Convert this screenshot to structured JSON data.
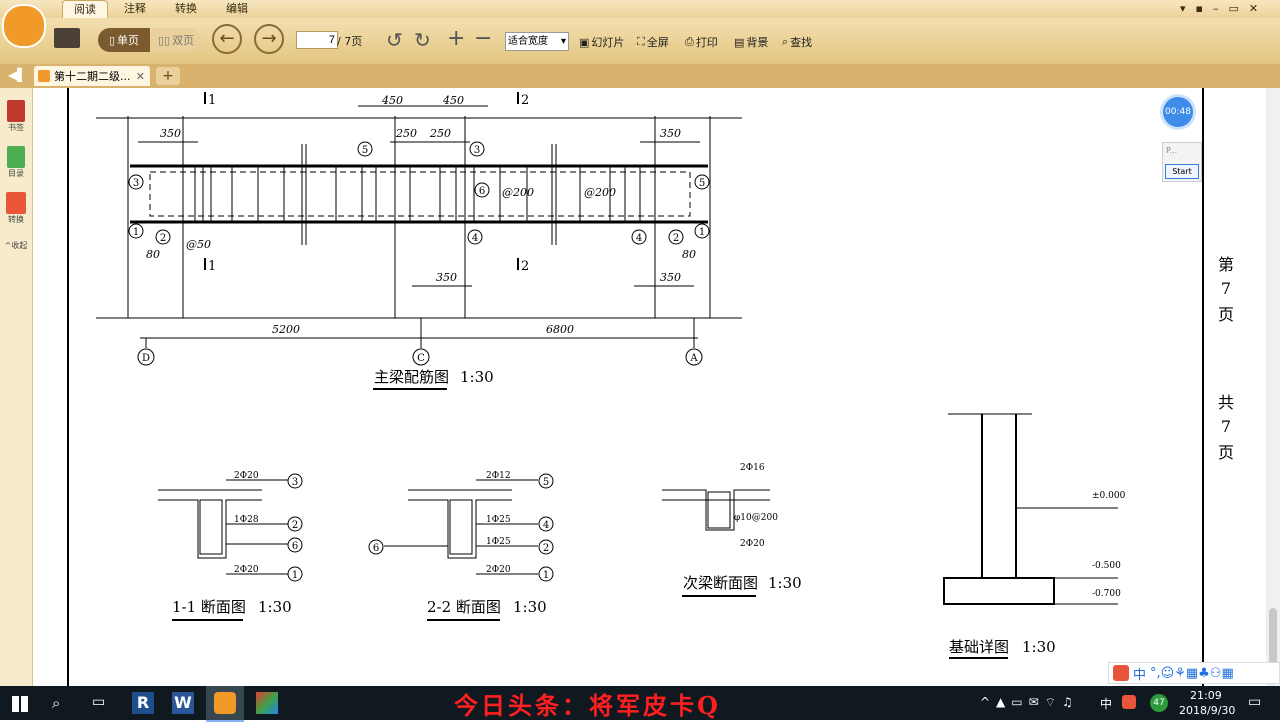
{
  "menu": {
    "tabs": [
      "阅读",
      "注释",
      "转换",
      "编辑"
    ]
  },
  "toolbar": {
    "single_page": "单页",
    "double_page": "双页",
    "page_current": "7",
    "page_total": "/ 7页",
    "zoom_mode": "适合宽度",
    "slideshow": "幻灯片",
    "fullscreen": "全屏",
    "print": "打印",
    "background": "背景",
    "find": "查找"
  },
  "tab": {
    "title": "第十二期二级..."
  },
  "sidebar": {
    "bookmark": "书签",
    "toc": "目录",
    "convert": "转换",
    "collapse": "收起"
  },
  "overlay": {
    "timer": "00:48",
    "widget_text": "P...",
    "start_button": "Start"
  },
  "drawing": {
    "beam_title": "主梁配筋图",
    "sec11_title": "1-1 断面图",
    "sec22_title": "2-2 断面图",
    "sec_sub_title": "次梁断面图",
    "found_title": "基础详图",
    "scale": "1:30",
    "dims_top": [
      "450",
      "450",
      "350",
      "250",
      "250",
      "350"
    ],
    "dims_mid": [
      "350",
      "350"
    ],
    "dims_bottom": [
      "5200",
      "6800"
    ],
    "spacings": [
      "@200",
      "@200",
      "@50"
    ],
    "dim80": "80",
    "axes": [
      "D",
      "C",
      "A"
    ],
    "markers": [
      "1",
      "2",
      "3",
      "4",
      "5",
      "6"
    ],
    "cut1": "1",
    "cut2": "2",
    "sec11_labels": [
      "2Φ20",
      "1Φ28",
      "2Φ20"
    ],
    "sec22_labels": [
      "2Φ12",
      "1Φ25",
      "1Φ25",
      "2Φ20"
    ],
    "sub_labels": [
      "2Φ16",
      "φ10@200",
      "2Φ20"
    ],
    "elevations": [
      "±0.000",
      "-0.500",
      "-0.700"
    ],
    "side": [
      "第",
      "7",
      "页",
      "共",
      "7",
      "页"
    ]
  },
  "watermark": "今日头条：将军皮卡Q",
  "taskbar": {
    "ime": "中",
    "temp": "47",
    "time": "21:09",
    "date": "2018/9/30"
  }
}
